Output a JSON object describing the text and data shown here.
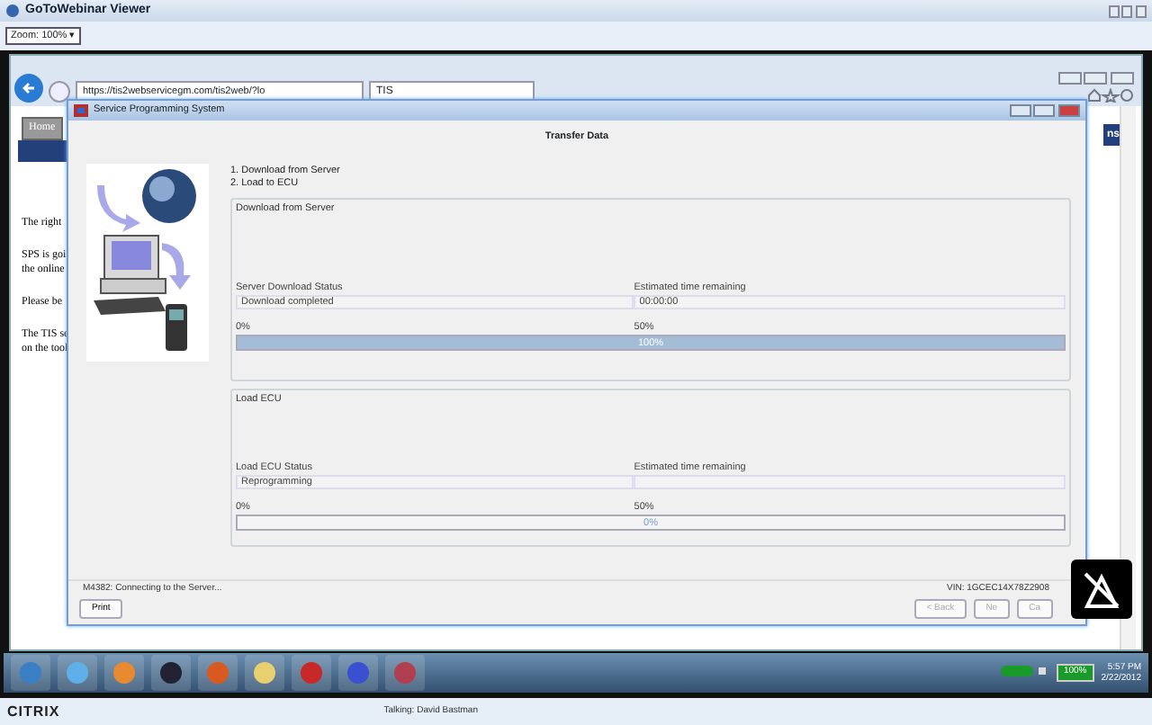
{
  "viewer": {
    "title": "GoToWebinar Viewer",
    "zoom": "Zoom: 100% ▾"
  },
  "browser": {
    "url": "https://tis2webservicegm.com/tis2web/?lo",
    "tab": "TIS"
  },
  "page": {
    "nav": [
      "Home"
    ],
    "side_label": "ns",
    "paragraphs": [
      [
        "The right"
      ],
      [
        "SPS is goi",
        "the online"
      ],
      [
        "Please be"
      ],
      [
        "The TIS se",
        "on the tool"
      ]
    ]
  },
  "dialog": {
    "title": "Service Programming System",
    "heading": "Transfer Data",
    "steps": [
      "1. Download from Server",
      "2. Load to ECU"
    ],
    "groups": [
      {
        "title": "Download from Server",
        "status_label": "Server Download Status",
        "status_value": "Download completed",
        "time_label": "Estimated time remaining",
        "time_value": "00:00:00",
        "min_label": "0%",
        "mid_label": "50%",
        "level": 1,
        "bar_text": "100%"
      },
      {
        "title": "Load ECU",
        "status_label": "Load ECU Status",
        "status_value": "Reprogramming",
        "time_label": "Estimated time remaining",
        "min_label": "0%",
        "mid_label": "50%",
        "level": 0,
        "bar_text": "0%"
      }
    ],
    "status_message": "M4382: Connecting to the Server...",
    "vin": "VIN: 1GCEC14X78Z2908",
    "buttons": [
      {
        "label": "Print",
        "disabled": false
      },
      {
        "label": "< Back",
        "disabled": true
      },
      {
        "label": "Ne",
        "disabled": true
      },
      {
        "label": "Ca",
        "disabled": true
      }
    ]
  },
  "taskbar": {
    "apps": [
      {
        "kind": "start"
      },
      {
        "kind": "ie"
      },
      {
        "kind": "media"
      },
      {
        "kind": "scanner"
      },
      {
        "kind": "firefox"
      },
      {
        "kind": "folder"
      },
      {
        "kind": "toolbox"
      },
      {
        "kind": "network"
      },
      {
        "kind": "tis"
      }
    ],
    "battery": "100%",
    "time": "5:57 PM",
    "date": "2/22/2012"
  },
  "footer": {
    "logo": "CITRIX",
    "talking": "Talking: David Bastman"
  }
}
